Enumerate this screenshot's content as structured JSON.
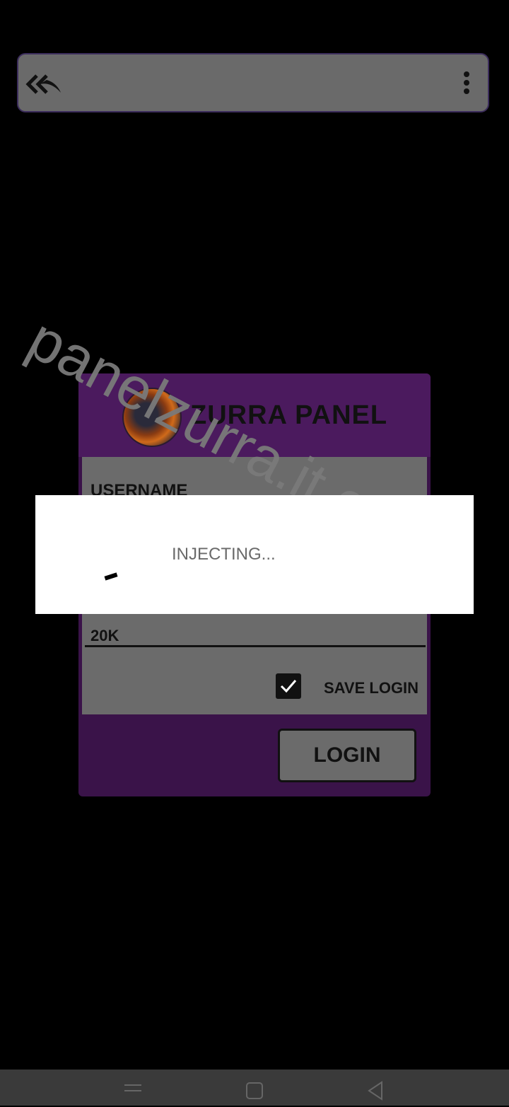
{
  "toolbar": {
    "back_icon": "double-back-arrow-icon",
    "menu_icon": "more-vertical-icon"
  },
  "watermark": {
    "text": "panelzurra.it.com"
  },
  "card": {
    "brand_name": "ZURRA PANEL",
    "username_label": "USERNAME",
    "key_value": "20K",
    "save_login_label": "SAVE LOGIN",
    "save_login_checked": true,
    "login_button_label": "LOGIN",
    "colors": {
      "header": "#4b1a5e",
      "body": "#3a1349",
      "form": "#6b6b6b"
    }
  },
  "dialog": {
    "message": "INJECTING..."
  },
  "navbar": {
    "items": [
      "menu-icon",
      "home-icon",
      "back-icon"
    ]
  }
}
